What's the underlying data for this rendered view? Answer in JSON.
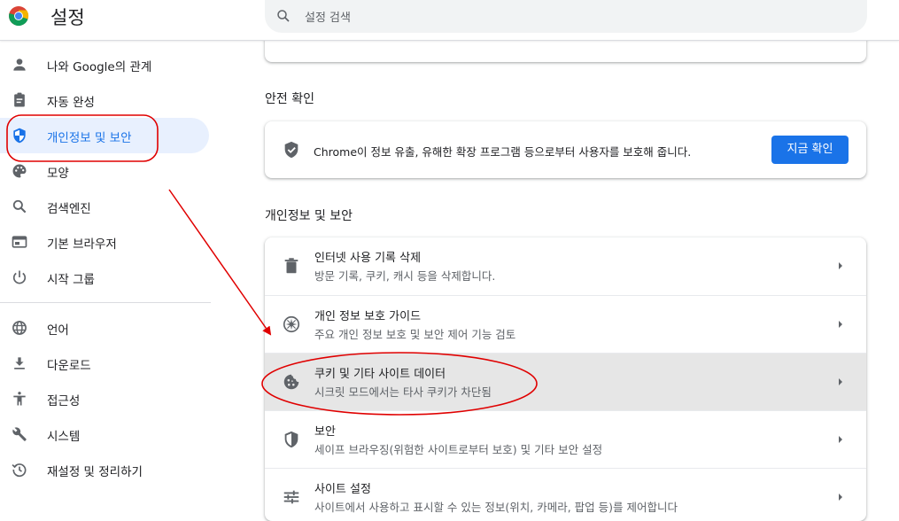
{
  "header": {
    "title": "설정",
    "logo_icon": "chrome-logo-icon",
    "search": {
      "placeholder": "설정 검색",
      "icon": "search-icon"
    }
  },
  "sidebar": {
    "items": [
      {
        "label": "나와 Google의 관계",
        "icon": "person-icon"
      },
      {
        "label": "자동 완성",
        "icon": "clipboard-icon"
      },
      {
        "label": "개인정보 및 보안",
        "icon": "shield-icon",
        "active": true
      },
      {
        "label": "모양",
        "icon": "palette-icon"
      },
      {
        "label": "검색엔진",
        "icon": "search-icon"
      },
      {
        "label": "기본 브라우저",
        "icon": "browser-icon"
      },
      {
        "label": "시작 그룹",
        "icon": "power-icon"
      },
      {
        "label": "언어",
        "icon": "globe-icon"
      },
      {
        "label": "다운로드",
        "icon": "download-icon"
      },
      {
        "label": "접근성",
        "icon": "accessibility-icon"
      },
      {
        "label": "시스템",
        "icon": "wrench-icon"
      },
      {
        "label": "재설정 및 정리하기",
        "icon": "history-icon"
      }
    ]
  },
  "main": {
    "safety_check": {
      "title": "안전 확인",
      "text": "Chrome이 정보 유출, 유해한 확장 프로그램 등으로부터 사용자를 보호해 줍니다.",
      "button": "지금 확인",
      "icon": "shield-check-icon"
    },
    "privacy": {
      "title": "개인정보 및 보안",
      "rows": [
        {
          "title": "인터넷 사용 기록 삭제",
          "subtitle": "방문 기록, 쿠키, 캐시 등을 삭제합니다.",
          "icon": "trash-icon"
        },
        {
          "title": "개인 정보 보호 가이드",
          "subtitle": "주요 개인 정보 보호 및 보안 제어 기능 검토",
          "icon": "compass-icon"
        },
        {
          "title": "쿠키 및 기타 사이트 데이터",
          "subtitle": "시크릿 모드에서는 타사 쿠키가 차단됨",
          "icon": "cookie-icon",
          "highlighted": true
        },
        {
          "title": "보안",
          "subtitle": "세이프 브라우징(위험한 사이트로부터 보호) 및 기타 보안 설정",
          "icon": "shield-half-icon"
        },
        {
          "title": "사이트 설정",
          "subtitle": "사이트에서 사용하고 표시할 수 있는 정보(위치, 카메라, 팝업 등)를 제어합니다",
          "icon": "sliders-icon"
        }
      ]
    }
  },
  "colors": {
    "accent": "#1a73e8",
    "active_nav_bg": "#e8f0fe",
    "highlight_row_bg": "#e6e6e6",
    "annotation": "#e00000"
  }
}
